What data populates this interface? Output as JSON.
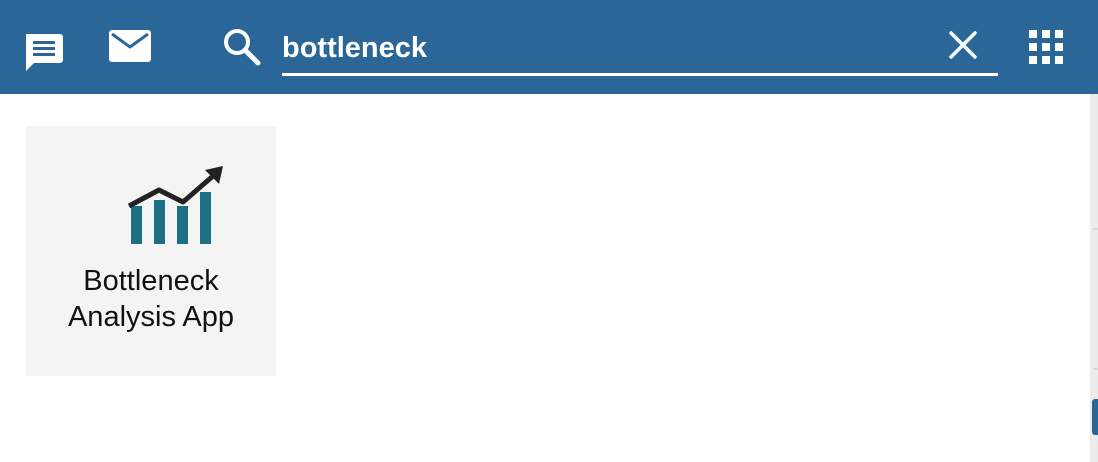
{
  "header": {
    "icons": {
      "chat": "chat-icon",
      "mail": "mail-icon",
      "search": "search-icon",
      "clear": "close-icon",
      "apps": "apps-grid-icon"
    },
    "search": {
      "value": "bottleneck",
      "placeholder": ""
    },
    "colors": {
      "bar": "#2a6698",
      "foreground": "#ffffff"
    }
  },
  "results": {
    "apps": [
      {
        "label_line1": "Bottleneck",
        "label_line2": "Analysis App",
        "icon": "bar-chart-trend-icon",
        "icon_colors": {
          "bars": "#1b7086",
          "arrow": "#222222"
        }
      }
    ]
  }
}
